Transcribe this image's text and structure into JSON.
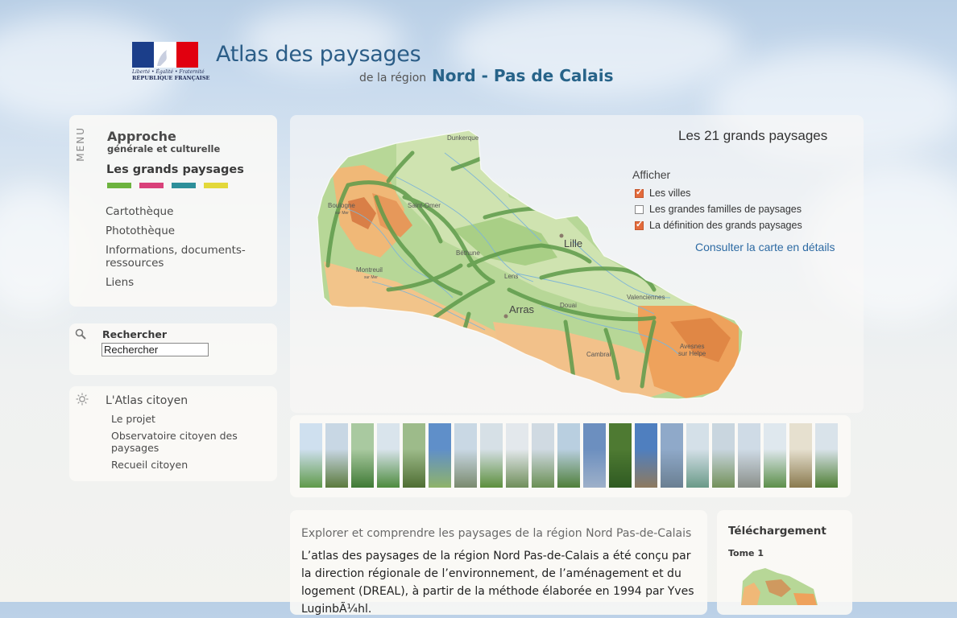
{
  "header": {
    "logo": {
      "motto": "Liberté • Égalité • Fraternité",
      "republic": "RÉPUBLIQUE FRANÇAISE",
      "flag_colors": [
        "#1b3e8a",
        "#ffffff",
        "#e1000f"
      ]
    },
    "title": "Atlas des paysages",
    "subtitle_prefix": "de la région",
    "subtitle_region": "Nord - Pas de Calais"
  },
  "menu": {
    "vertical_label": "MENU",
    "approche_title": "Approche",
    "approche_subtitle": "générale et culturelle",
    "active_title": "Les grands paysages",
    "swatch_colors": [
      "#6db33f",
      "#d9417a",
      "#2e8f9a",
      "#e3d83a"
    ],
    "links": [
      "Cartothèque",
      "Photothèque",
      "Informations, documents-",
      "ressources",
      "Liens"
    ]
  },
  "search": {
    "label": "Rechercher",
    "value": "Rechercher",
    "icon": "magnifier-icon"
  },
  "citoyen": {
    "title": "L'Atlas citoyen",
    "icon": "sun-icon",
    "links": [
      "Le projet",
      "Observatoire citoyen des",
      "paysages",
      "Recueil citoyen"
    ]
  },
  "map": {
    "title": "Les 21 grands paysages",
    "afficher_label": "Afficher",
    "options": [
      {
        "label": "Les villes",
        "checked": true
      },
      {
        "label": "Les grandes familles de paysages",
        "checked": false
      },
      {
        "label": "La définition des grands paysages",
        "checked": true
      }
    ],
    "consult_link": "Consulter la carte en détails",
    "cities": {
      "dunkerque": "Dunkerque",
      "boulogne": "Boulogne",
      "boulogne_sub": "sur Mer",
      "saint_omer": "Saint-Omer",
      "lille": "Lille",
      "bethune": "Béthune",
      "montreuil": "Montreuil",
      "montreuil_sub": "sur Mer",
      "lens": "Lens",
      "arras": "Arras",
      "douai": "Douai",
      "valenciennes": "Valenciennes",
      "cambrai": "Cambrai",
      "avesnes": "Avesnes",
      "avesnes_sub": "sur Helpe"
    }
  },
  "thumbnails": [
    {
      "name": "landscape-photo-1",
      "color_top": "#cfe0ef",
      "color_bottom": "#5f9a4a"
    },
    {
      "name": "landscape-photo-2",
      "color_top": "#c8d7e4",
      "color_bottom": "#5b7a3d"
    },
    {
      "name": "landscape-photo-3",
      "color_top": "#a9c9a0",
      "color_bottom": "#3f7a35"
    },
    {
      "name": "landscape-photo-4",
      "color_top": "#d9e4ec",
      "color_bottom": "#4d8b3e"
    },
    {
      "name": "landscape-photo-5",
      "color_top": "#9dbb8a",
      "color_bottom": "#4f6e33"
    },
    {
      "name": "landscape-photo-6",
      "color_top": "#5f8fc9",
      "color_bottom": "#8fb36a"
    },
    {
      "name": "landscape-photo-7",
      "color_top": "#c9d8e4",
      "color_bottom": "#7a8a6e"
    },
    {
      "name": "landscape-photo-8",
      "color_top": "#d6e0e6",
      "color_bottom": "#5c8f3d"
    },
    {
      "name": "landscape-photo-9",
      "color_top": "#e3e8ec",
      "color_bottom": "#6f8e5a"
    },
    {
      "name": "landscape-photo-10",
      "color_top": "#d0dae2",
      "color_bottom": "#6a8f54"
    },
    {
      "name": "landscape-photo-11",
      "color_top": "#b9cfe0",
      "color_bottom": "#4f7f3a"
    },
    {
      "name": "landscape-photo-12",
      "color_top": "#6c8fbf",
      "color_bottom": "#9eb0c9"
    },
    {
      "name": "landscape-photo-13",
      "color_top": "#4e7a32",
      "color_bottom": "#2f5a22"
    },
    {
      "name": "landscape-photo-14",
      "color_top": "#4f7fbf",
      "color_bottom": "#8e7a5f"
    },
    {
      "name": "landscape-photo-15",
      "color_top": "#8fa9c9",
      "color_bottom": "#6a7f92"
    },
    {
      "name": "landscape-photo-16",
      "color_top": "#d4e0e8",
      "color_bottom": "#6a9a88"
    },
    {
      "name": "landscape-photo-17",
      "color_top": "#c9d6df",
      "color_bottom": "#73915a"
    },
    {
      "name": "landscape-photo-18",
      "color_top": "#cfdbe6",
      "color_bottom": "#8a8f8a"
    },
    {
      "name": "landscape-photo-19",
      "color_top": "#dfe8ee",
      "color_bottom": "#5c8f4a"
    },
    {
      "name": "landscape-photo-20",
      "color_top": "#e6e0cf",
      "color_bottom": "#8a7a4f"
    },
    {
      "name": "landscape-photo-21",
      "color_top": "#d9e3ea",
      "color_bottom": "#4f7f35"
    }
  ],
  "explore": {
    "title": "Explorer et comprendre les paysages de la région Nord Pas-de-Calais",
    "text": "L’atlas des paysages de la région Nord Pas-de-Calais a été conçu par la direction régionale de l’environnement, de l’aménagement et du logement (DREAL), à partir de la méthode élaborée en 1994 par Yves LuginbÃ¼hl."
  },
  "download": {
    "title": "Téléchargement",
    "tome": "Tome 1"
  }
}
